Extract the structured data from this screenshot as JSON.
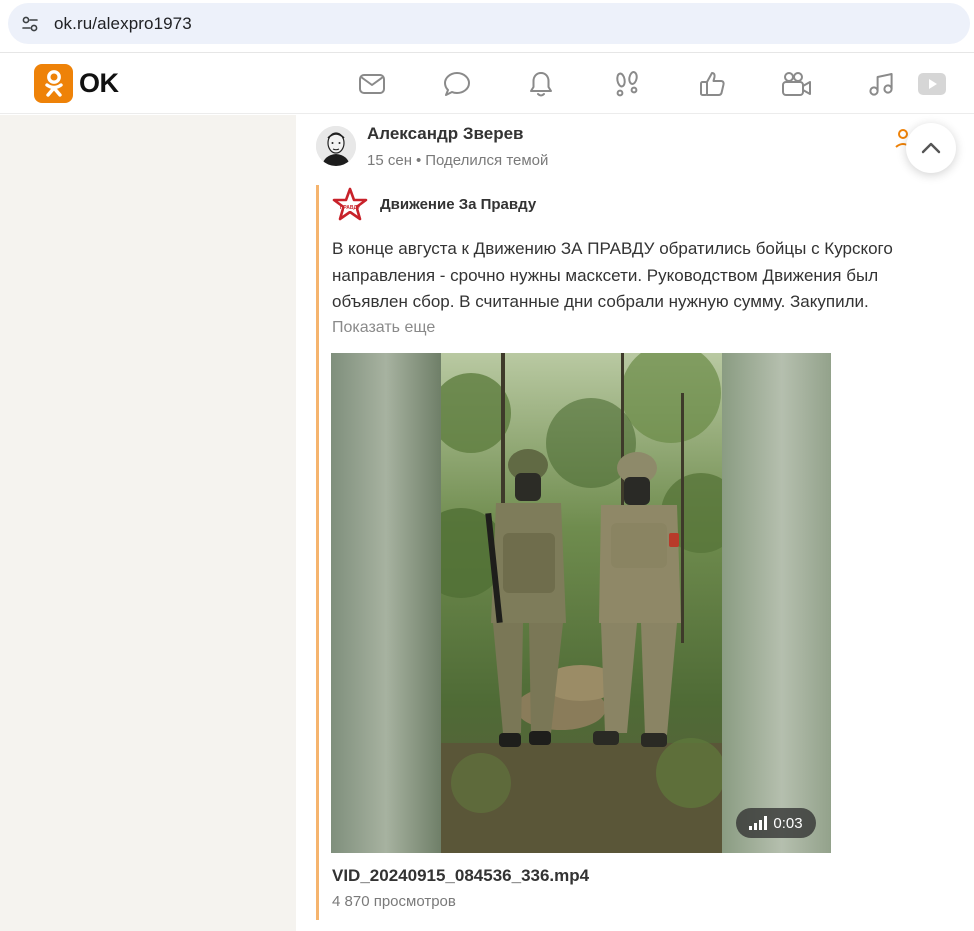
{
  "browser": {
    "url": "ok.ru/alexpro1973",
    "tune_icon": "site-settings-icon"
  },
  "header": {
    "logo_text": "OK",
    "nav": [
      {
        "name": "messages-icon"
      },
      {
        "name": "discussions-icon"
      },
      {
        "name": "notifications-icon"
      },
      {
        "name": "guests-icon"
      },
      {
        "name": "likes-icon"
      },
      {
        "name": "video-icon"
      },
      {
        "name": "music-icon"
      },
      {
        "name": "video-player-icon"
      }
    ]
  },
  "post": {
    "author": "Александр Зверев",
    "date": "15 сен",
    "dot": "•",
    "action": "Поделился темой",
    "shared": {
      "group_name": "Движение За Правду",
      "text": "В конце августа к Движению ЗА ПРАВДУ обратились бойцы с Курского направления - срочно нужны масксети. Руководством Движения был объявлен сбор. В считанные дни собрали нужную сумму. Закупили.",
      "show_more": "Показать еще",
      "video": {
        "duration": "0:03",
        "filename": "VID_20240915_084536_336.mp4",
        "views": "4 870 просмотров"
      }
    }
  },
  "colors": {
    "brand": "#ee8208",
    "accent_line": "#f5b46e",
    "sidebar_bg": "#f5f3ef"
  }
}
